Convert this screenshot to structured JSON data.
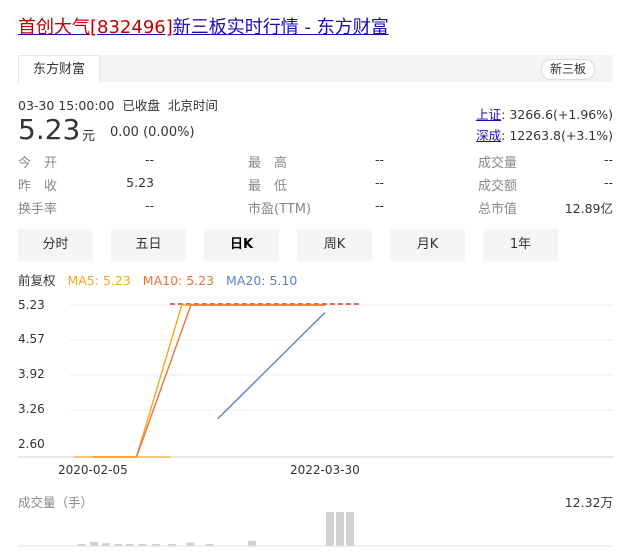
{
  "page": {
    "title_stock": "首创大气",
    "title_code": "[832496]",
    "title_rest": "新三板实时行情 - 东方财富"
  },
  "source_tab": {
    "label": "东方财富"
  },
  "market_badge": "新三板",
  "quote": {
    "datetime": "03-30 15:00:00",
    "status": "已收盘",
    "timezone": "北京时间",
    "price": "5.23",
    "unit": "元",
    "change": "0.00 (0.00%)"
  },
  "indices": [
    {
      "name": "上证",
      "value": "3266.6(+1.96%)"
    },
    {
      "name": "深成",
      "value": "12263.8(+3.1%)"
    }
  ],
  "stats": {
    "open": {
      "label": "今　开",
      "value": "--"
    },
    "prev": {
      "label": "昨　收",
      "value": "5.23"
    },
    "turnover": {
      "label": "换手率",
      "value": "--"
    },
    "high": {
      "label": "最　高",
      "value": "--"
    },
    "low": {
      "label": "最　低",
      "value": "--"
    },
    "pe": {
      "label": "市盈(TTM)",
      "value": "--"
    },
    "volume": {
      "label": "成交量",
      "value": "--"
    },
    "amount": {
      "label": "成交额",
      "value": "--"
    },
    "mktcap": {
      "label": "总市值",
      "value": "12.89亿"
    }
  },
  "tabs": [
    {
      "label": "分时"
    },
    {
      "label": "五日"
    },
    {
      "label": "日K",
      "active": true
    },
    {
      "label": "周K"
    },
    {
      "label": "月K"
    },
    {
      "label": "1年"
    }
  ],
  "legend": {
    "adj": "前复权",
    "ma5": "MA5: 5.23",
    "ma10": "MA10: 5.23",
    "ma20": "MA20: 5.10"
  },
  "colors": {
    "ma5": "#f5a623",
    "ma10": "#e8743b",
    "ma20": "#5b7fd6",
    "price_red": "#e03c3c",
    "vol_bar": "#d0d0d0"
  },
  "chart_data": {
    "type": "line",
    "title": "",
    "xlabel": "",
    "ylabel": "",
    "y_ticks": [
      "5.23",
      "4.57",
      "3.92",
      "3.26",
      "2.60"
    ],
    "ylim": [
      2.6,
      5.23
    ],
    "x_ticks": [
      "2020-02-05",
      "2022-03-30"
    ],
    "series": [
      {
        "name": "MA5",
        "x": [
          "2020-02-05",
          "2020-07-01",
          "2020-12-01",
          "2022-03-30"
        ],
        "values": [
          2.6,
          2.6,
          5.23,
          5.23
        ]
      },
      {
        "name": "MA10",
        "x": [
          "2020-02-05",
          "2020-07-01",
          "2021-01-01",
          "2022-03-30"
        ],
        "values": [
          2.6,
          2.6,
          5.23,
          5.23
        ]
      },
      {
        "name": "MA20",
        "x": [
          "2021-04-01",
          "2022-03-30"
        ],
        "values": [
          3.26,
          5.1
        ]
      }
    ],
    "volume": {
      "label": "成交量（手）",
      "max_label": "12.32万",
      "bars": [
        0.05,
        0.12,
        0.08,
        0.06,
        0.04,
        0.03,
        0.05,
        0.04,
        0.1,
        0.06,
        0.15,
        1.0,
        1.0,
        1.0
      ]
    }
  }
}
